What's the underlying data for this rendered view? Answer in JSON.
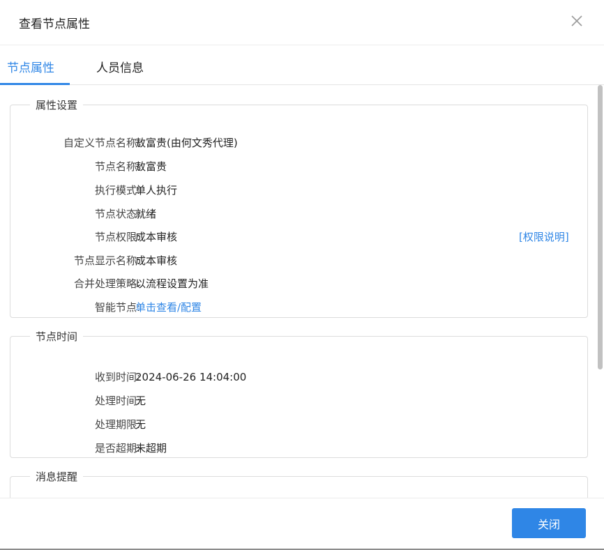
{
  "dialog": {
    "title": "查看节点属性",
    "close_icon": "close-icon"
  },
  "tabs": [
    {
      "label": "节点属性",
      "active": true
    },
    {
      "label": "人员信息",
      "active": false
    }
  ],
  "groups": {
    "attributes": {
      "title": "属性设置",
      "rows": [
        {
          "label": "自定义节点名称:",
          "value": "敖富贵(由何文秀代理)"
        },
        {
          "label": "节点名称:",
          "value": "敖富贵"
        },
        {
          "label": "执行模式:",
          "value": "单人执行"
        },
        {
          "label": "节点状态:",
          "value": "就绪"
        },
        {
          "label": "节点权限:",
          "value": "成本审核"
        },
        {
          "label": "节点显示名称:",
          "value": "成本审核"
        },
        {
          "label": "合并处理策略:",
          "value": "以流程设置为准"
        },
        {
          "label": "智能节点:",
          "value": "单击查看/配置"
        }
      ],
      "permission_link": "[权限说明]"
    },
    "time": {
      "title": "节点时间",
      "rows": [
        {
          "label": "收到时间:",
          "value": "2024-06-26 14:04:00"
        },
        {
          "label": "处理时间:",
          "value": "无"
        },
        {
          "label": "处理期限:",
          "value": "无"
        },
        {
          "label": "是否超期:",
          "value": "未超期"
        }
      ]
    },
    "message": {
      "title": "消息提醒"
    }
  },
  "footer": {
    "close_label": "关闭"
  },
  "colors": {
    "accent": "#2f86e6"
  }
}
